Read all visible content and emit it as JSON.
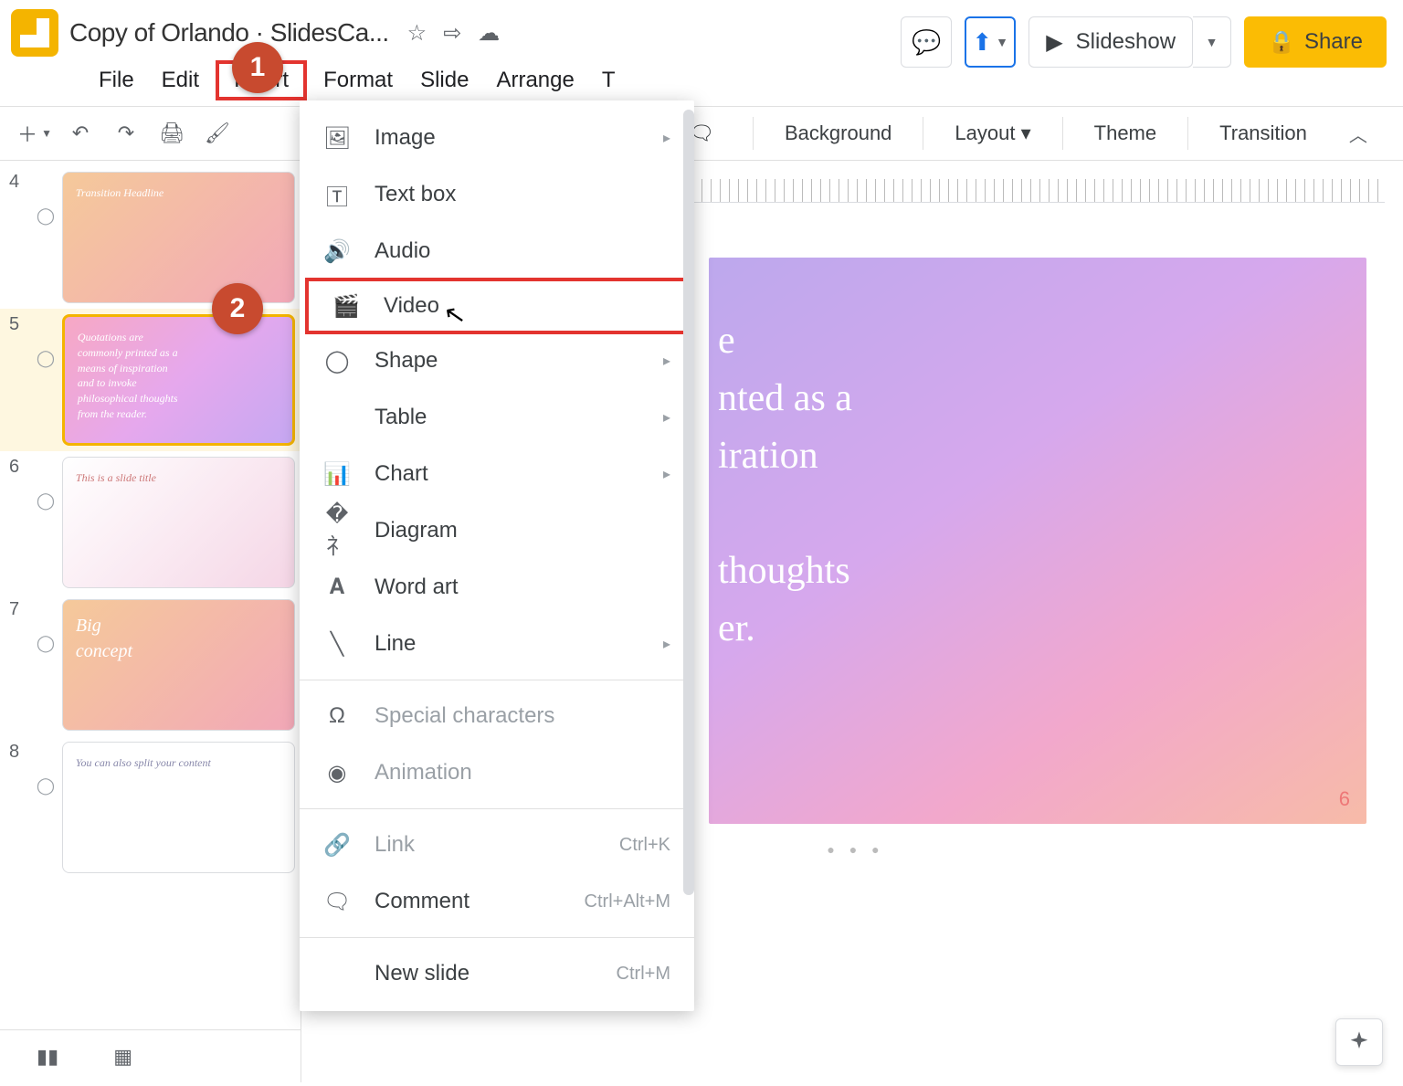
{
  "doc_title": "Copy of Orlando · SlidesCa...",
  "menus": {
    "file": "File",
    "edit": "Edit",
    "insert": "Insert",
    "format": "Format",
    "slide": "Slide",
    "arrange": "Arrange",
    "t": "T"
  },
  "buttons": {
    "slideshow": "Slideshow",
    "share": "Share"
  },
  "toolbar": {
    "background": "Background",
    "layout": "Layout",
    "theme": "Theme",
    "transition": "Transition"
  },
  "dropdown": {
    "image": "Image",
    "textbox": "Text box",
    "audio": "Audio",
    "video": "Video",
    "shape": "Shape",
    "table": "Table",
    "chart": "Chart",
    "diagram": "Diagram",
    "wordart": "Word art",
    "line": "Line",
    "special": "Special characters",
    "animation": "Animation",
    "link": "Link",
    "link_sc": "Ctrl+K",
    "comment": "Comment",
    "comment_sc": "Ctrl+Alt+M",
    "newslide": "New slide",
    "newslide_sc": "Ctrl+M"
  },
  "callouts": {
    "one": "1",
    "two": "2"
  },
  "thumbs": {
    "n4": "4",
    "n5": "5",
    "n6": "6",
    "n7": "7",
    "n8": "8",
    "t4": "Transition Headline",
    "t5": "Quotations are\ncommonly printed as a\nmeans of inspiration\nand to invoke\nphilosophical thoughts\nfrom the reader.",
    "t6": "This is a slide title",
    "t7": "Big\nconcept",
    "t8": "You can also split your content"
  },
  "canvas": {
    "text": "e\nnted as a\niration\n\nthoughts\ner.",
    "num": "6"
  }
}
